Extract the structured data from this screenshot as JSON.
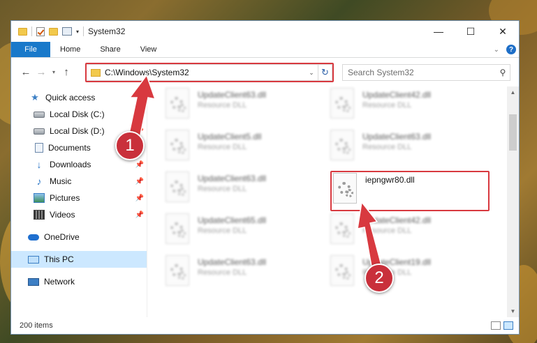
{
  "window": {
    "title": "System32",
    "controls": {
      "minimize": "—",
      "maximize": "☐",
      "close": "✕"
    }
  },
  "ribbon": {
    "tabs": [
      "File",
      "Home",
      "Share",
      "View"
    ]
  },
  "address_bar": {
    "path": "C:\\Windows\\System32",
    "search_placeholder": "Search System32"
  },
  "nav_pane": {
    "quick_access": "Quick access",
    "items": [
      {
        "label": "Local Disk (C:)",
        "icon": "disk-icon",
        "pinned": true
      },
      {
        "label": "Local Disk (D:)",
        "icon": "disk-icon",
        "pinned": true
      },
      {
        "label": "Documents",
        "icon": "documents-icon",
        "pinned": true
      },
      {
        "label": "Downloads",
        "icon": "download-icon",
        "pinned": true
      },
      {
        "label": "Music",
        "icon": "music-icon",
        "pinned": true
      },
      {
        "label": "Pictures",
        "icon": "pictures-icon",
        "pinned": true
      },
      {
        "label": "Videos",
        "icon": "videos-icon",
        "pinned": true
      }
    ],
    "onedrive": "OneDrive",
    "this_pc": "This PC",
    "network": "Network"
  },
  "files": [
    {
      "name": "UpdateClient63.dll",
      "type": "Resource DLL",
      "blurred": true
    },
    {
      "name": "UpdateClient42.dll",
      "type": "Resource DLL",
      "blurred": true
    },
    {
      "name": "UpdateClient5.dll",
      "type": "Resource DLL",
      "blurred": true
    },
    {
      "name": "UpdateClient63.dll",
      "type": "Resource DLL",
      "blurred": true
    },
    {
      "name": "UpdateClient63.dll",
      "type": "Resource DLL",
      "blurred": true
    },
    {
      "name": "iepngwr80.dll",
      "type": "",
      "blurred": false
    },
    {
      "name": "UpdateClient65.dll",
      "type": "Resource DLL",
      "blurred": true
    },
    {
      "name": "UpdateClient42.dll",
      "type": "Resource DLL",
      "blurred": true
    },
    {
      "name": "UpdateClient63.dll",
      "type": "Resource DLL",
      "blurred": true
    },
    {
      "name": "UpdateClient19.dll",
      "type": "Resource DLL",
      "blurred": true
    }
  ],
  "status": {
    "item_count": "200 items"
  },
  "annotations": {
    "step1": "1",
    "step2": "2",
    "highlight_color": "#d8393f"
  }
}
